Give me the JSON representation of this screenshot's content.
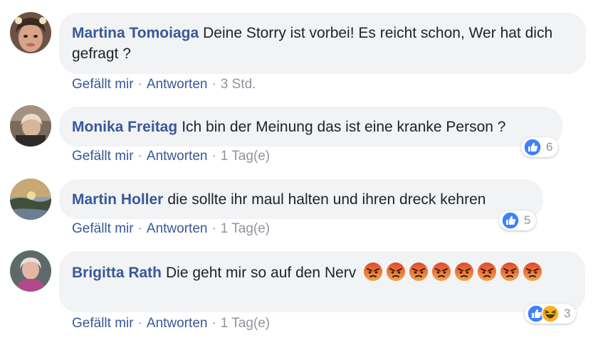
{
  "colors": {
    "link": "#385898",
    "meta": "#90949c",
    "bubble": "#f2f3f5",
    "like": "#4080ff",
    "angry": "#e04a2b",
    "haha": "#f7b125"
  },
  "comments": [
    {
      "author": "Martina Tomoiaga",
      "text": "Deine Storry ist vorbei! Es reicht schon, Wer hat dich gefragt ?",
      "like_label": "Gefällt mir",
      "reply_label": "Antworten",
      "time": "3 Std.",
      "reactions": null
    },
    {
      "author": "Monika Freitag",
      "text": "Ich bin der Meinung das ist eine kranke Person ?",
      "like_label": "Gefällt mir",
      "reply_label": "Antworten",
      "time": "1 Tag(e)",
      "reactions": {
        "icons": [
          "like-icon"
        ],
        "count": "6"
      }
    },
    {
      "author": "Martin Holler",
      "text": "die sollte ihr maul halten und ihren dreck kehren",
      "like_label": "Gefällt mir",
      "reply_label": "Antworten",
      "time": "1 Tag(e)",
      "reactions": {
        "icons": [
          "like-icon"
        ],
        "count": "5"
      }
    },
    {
      "author": "Brigitta Rath",
      "text": "Die geht mir so auf den Nerv",
      "emoji": [
        "angry-face-icon",
        "angry-face-icon",
        "angry-face-icon",
        "angry-face-icon",
        "angry-face-icon",
        "angry-face-icon",
        "angry-face-icon",
        "angry-face-icon"
      ],
      "like_label": "Gefällt mir",
      "reply_label": "Antworten",
      "time": "1 Tag(e)",
      "reactions": {
        "icons": [
          "like-icon",
          "haha-icon"
        ],
        "count": "3"
      }
    }
  ]
}
